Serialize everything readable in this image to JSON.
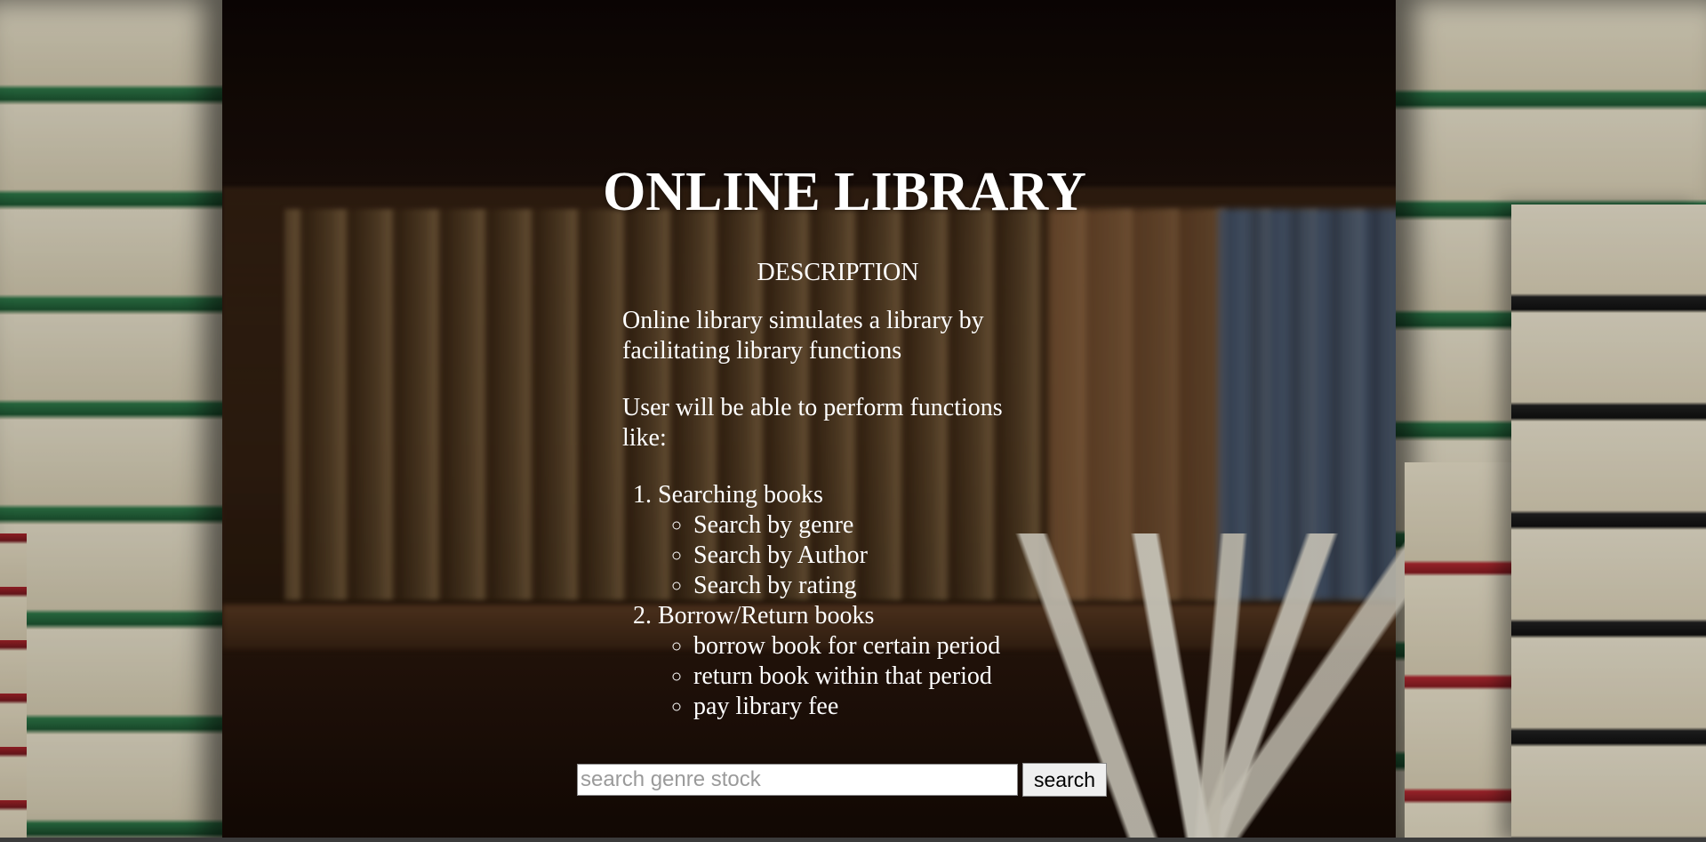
{
  "page": {
    "title": "ONLINE LIBRARY"
  },
  "description": {
    "heading": "DESCRIPTION",
    "paragraphs": [
      "Online library simulates a library by facilitating library functions",
      "User will be able to perform functions like:"
    ],
    "features": [
      {
        "label": "Searching books",
        "subitems": [
          "Search by genre",
          "Search by Author",
          "Search by rating"
        ]
      },
      {
        "label": "Borrow/Return books",
        "subitems": [
          "borrow book for certain period",
          "return book within that period",
          "pay library fee"
        ]
      }
    ]
  },
  "search": {
    "placeholder": "search genre stock",
    "value": "",
    "button_label": "search"
  },
  "background": {
    "icon": "library-bookshelf-photo"
  }
}
